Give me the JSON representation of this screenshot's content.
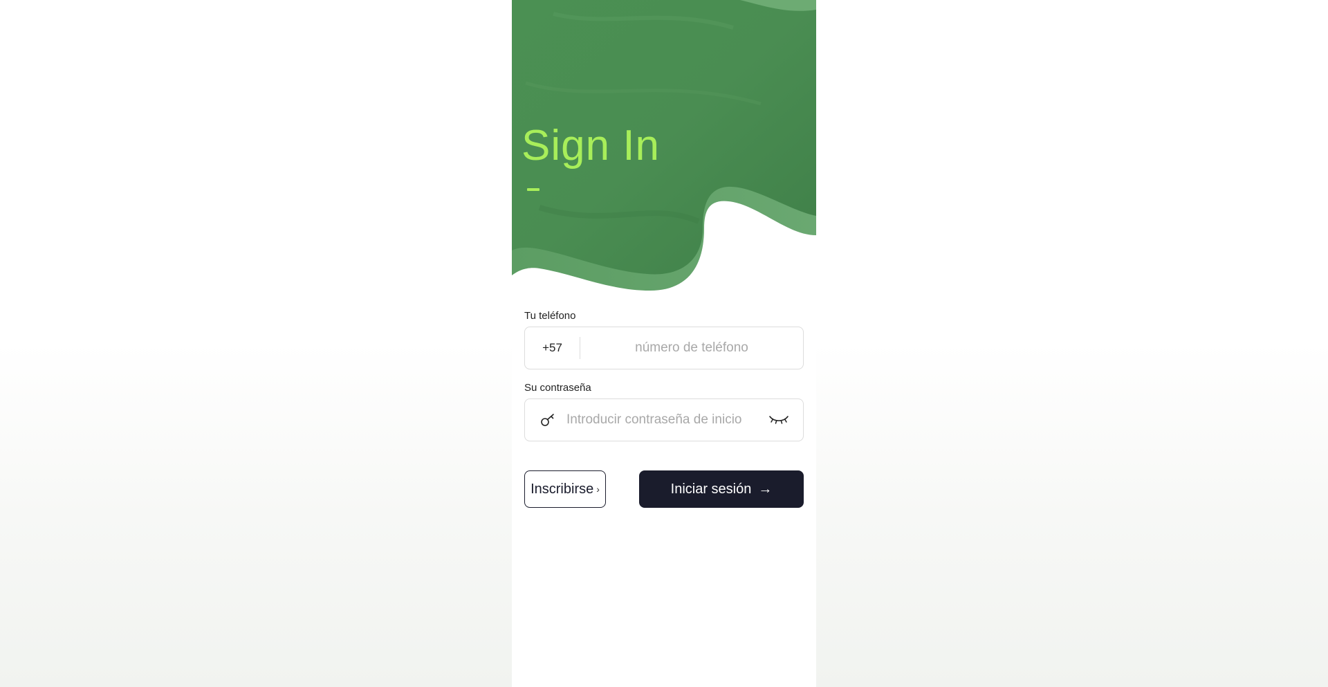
{
  "hero": {
    "title": "Sign In"
  },
  "form": {
    "phone": {
      "label": "Tu teléfono",
      "prefix": "+57",
      "placeholder": "número de teléfono"
    },
    "password": {
      "label": "Su contraseña",
      "placeholder": "Introducir contraseña de inicio"
    }
  },
  "actions": {
    "signup_label": "Inscribirse",
    "signin_label": "Iniciar sesión"
  },
  "icons": {
    "password_field": "key-icon",
    "toggle_visibility": "eye-closed-icon",
    "signup_chevron": "chevron-right-icon",
    "signin_arrow": "arrow-right-icon"
  },
  "colors": {
    "hero_green": "#4f9356",
    "title_accent": "#a8ee5a",
    "primary_button": "#1a1c2c"
  }
}
